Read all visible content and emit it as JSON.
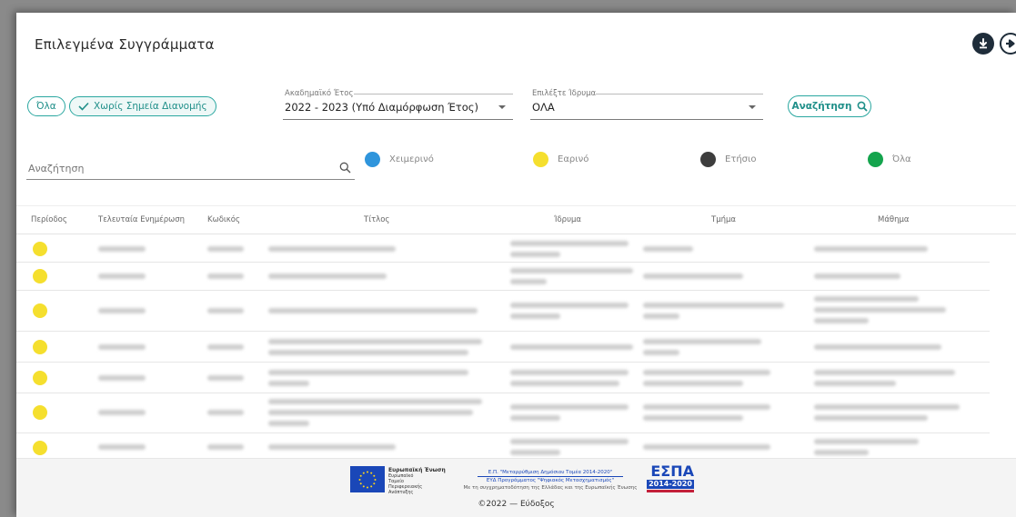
{
  "page": {
    "title": "Επιλεγμένα Συγγράμματα"
  },
  "toolbar": {
    "download_icon": "download-icon",
    "next_icon": "arrow-right-icon"
  },
  "filters": {
    "chip_all": "Όλα",
    "chip_no_distribution": "Χωρίς Σημεία Διανομής",
    "academic_year": {
      "legend": "Ακαδημαϊκό Έτος",
      "value": "2022 - 2023 (Υπό Διαμόρφωση Έτος)"
    },
    "institution": {
      "legend": "Επιλέξτε Ίδρυμα",
      "value": "ΟΛΑ"
    },
    "search_button": "Αναζήτηση"
  },
  "search": {
    "placeholder": "Αναζήτηση"
  },
  "legend": {
    "items": [
      {
        "label": "Χειμερινό",
        "color": "#2f95dc"
      },
      {
        "label": "Εαρινό",
        "color": "#f5df2e"
      },
      {
        "label": "Ετήσιο",
        "color": "#3d3d3d"
      },
      {
        "label": "Όλα",
        "color": "#14a44d"
      }
    ]
  },
  "table": {
    "headers": [
      "Περίοδος",
      "Τελευταία Ενημέρωση",
      "Κωδικός",
      "Τίτλος",
      "Ίδρυμα",
      "Τμήμα",
      "Μάθημα"
    ],
    "row_period_color": "#f5df2e"
  },
  "footer": {
    "eu_title": "Ευρωπαϊκή Ένωση",
    "eu_sub": "Ευρωπαϊκό Ταμείο Περιφερειακής Ανάπτυξης",
    "ep_title": "Ε.Π. \"Μεταρρύθμιση Δημόσιου Τομέα 2014-2020\"",
    "ep_line2": "ΕΥΔ Προγράμματος \"Ψηφιακός Μετασχηματισμός\"",
    "ep_line3": "Με τη συγχρηματοδότηση της Ελλάδας και της Ευρωπαϊκής Ένωσης",
    "espa_logo": "ΕΣΠΑ",
    "espa_years": "2014-2020",
    "copyright": "©2022 — Εύδοξος"
  }
}
